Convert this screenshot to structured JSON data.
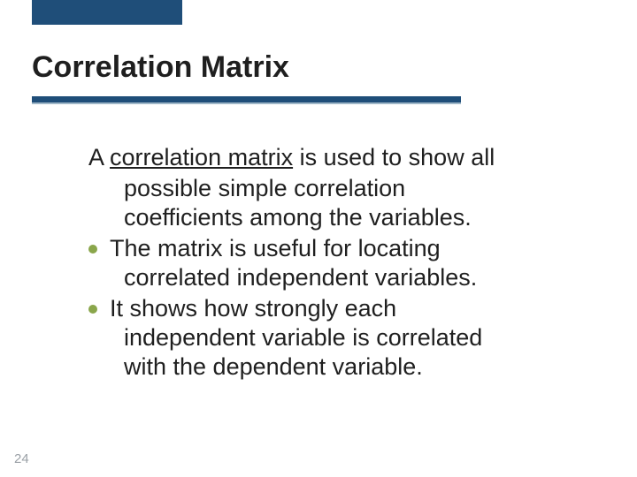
{
  "title": "Correlation Matrix",
  "body": {
    "lead_part1": "A ",
    "lead_underlined": "correlation matrix",
    "lead_part2": " is used to show all",
    "lead_line2": "possible simple correlation",
    "lead_line3": "coefficients among the variables.",
    "bullets": [
      {
        "line1": "The matrix is useful for locating",
        "line2": "correlated independent variables."
      },
      {
        "line1": "It shows how strongly each",
        "line2": "independent variable is correlated",
        "line3": "with the dependent variable."
      }
    ]
  },
  "page_number": "24",
  "colors": {
    "accent_bar": "#1f4e79",
    "bullet": "#8aa64b"
  }
}
